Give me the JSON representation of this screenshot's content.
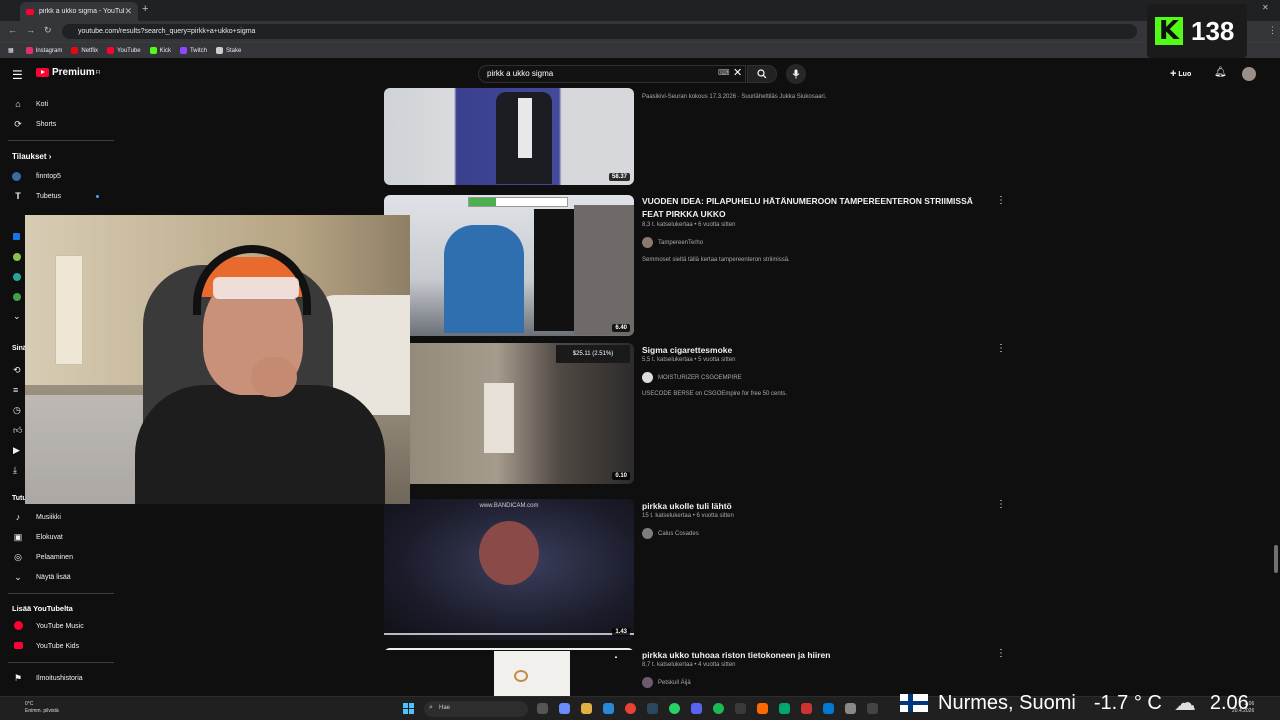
{
  "browser": {
    "tab_title": "pirkk a ukko sigma - YouTube",
    "tab_close": "✕",
    "new_tab": "+",
    "url": "youtube.com/results?search_query=pirkk+a+ukko+sigma",
    "bookmarks": [
      {
        "label": "Instagram",
        "color": "#e1306c"
      },
      {
        "label": "Netflix",
        "color": "#e50914"
      },
      {
        "label": "YouTube",
        "color": "#ff0033"
      },
      {
        "label": "Kick",
        "color": "#53fc18"
      },
      {
        "label": "Twitch",
        "color": "#9146ff"
      },
      {
        "label": "Stake",
        "color": "#cccccc"
      }
    ]
  },
  "kick_overlay": {
    "logo": "K",
    "viewer_count": "138"
  },
  "header": {
    "logo_text": "Premium",
    "logo_sup": "FI",
    "search_value": "pirkk a ukko sigma",
    "create_label": "Luo"
  },
  "sidebar": {
    "home": "Koti",
    "shorts": "Shorts",
    "subscriptions_heading": "Tilaukset",
    "subscriptions": [
      "finntop5",
      "Tubetus"
    ],
    "you_heading": "Sinä",
    "explore_heading": "Tutustu",
    "explore": [
      "Musiikki",
      "Elokuvat",
      "Pelaaminen",
      "Näytä lisää"
    ],
    "more_heading": "Lisää YouTubelta",
    "more": [
      "YouTube Music",
      "YouTube Kids"
    ],
    "report_history": "Ilmoitushistoria"
  },
  "results": [
    {
      "title": "",
      "meta": "",
      "channel": "",
      "description": "Paasikivi-Seuran kokous 17.3.2026 · Suurlähettiläs Jukka Siukosaari.",
      "duration": "58.37"
    },
    {
      "title": "VUODEN IDEA: PILAPUHELU HÄTÄNUMEROON TAMPEREENTERON STRIIMISSÄ FEAT PIRKKA UKKO",
      "meta": "8,3 t. katselukertaa • 6 vuotta sitten",
      "channel": "TampereenTerho",
      "description": "Semmoset sieltä tällä kertaa tampereenteron striimissä.",
      "duration": "6.40"
    },
    {
      "title": "Sigma cigarettesmoke",
      "meta": "5,5 t. katselukertaa • 5 vuotta sitten",
      "channel": "MOISTURIZER CSGOEMPIRE",
      "description": "USECODE BERSE on CSGOEmpire for free 50 cents.",
      "duration": "0.10",
      "thumb_overlay": "$25.11 (2.51%)"
    },
    {
      "title": "pirkka ukolle tuli lähtö",
      "meta": "15 t. katselukertaa • 6 vuotta sitten",
      "channel": "Calus Cosades",
      "description": "",
      "duration": "1.43",
      "thumb_overlay": "www.BANDICAM.com"
    },
    {
      "title": "pirkka ukko tuhoaa riston tietokoneen ja hiiren",
      "meta": "8,7 t. katselukertaa • 4 vuotta sitten",
      "channel": "Petskull Äijä",
      "description": "",
      "duration": ""
    }
  ],
  "taskbar": {
    "weather_temp": "0°C",
    "weather_desc": "Enimm. pilvistä",
    "search_placeholder": "Hae",
    "overlay_location": "Nurmes, Suomi",
    "overlay_temp": "-1.7 ° C",
    "overlay_time": "2.06",
    "tray_time": "2.06",
    "tray_date": "20.4.2026"
  },
  "colors": {
    "accent": "#ff0033",
    "kick": "#53fc18",
    "background": "#0f0f0f"
  }
}
